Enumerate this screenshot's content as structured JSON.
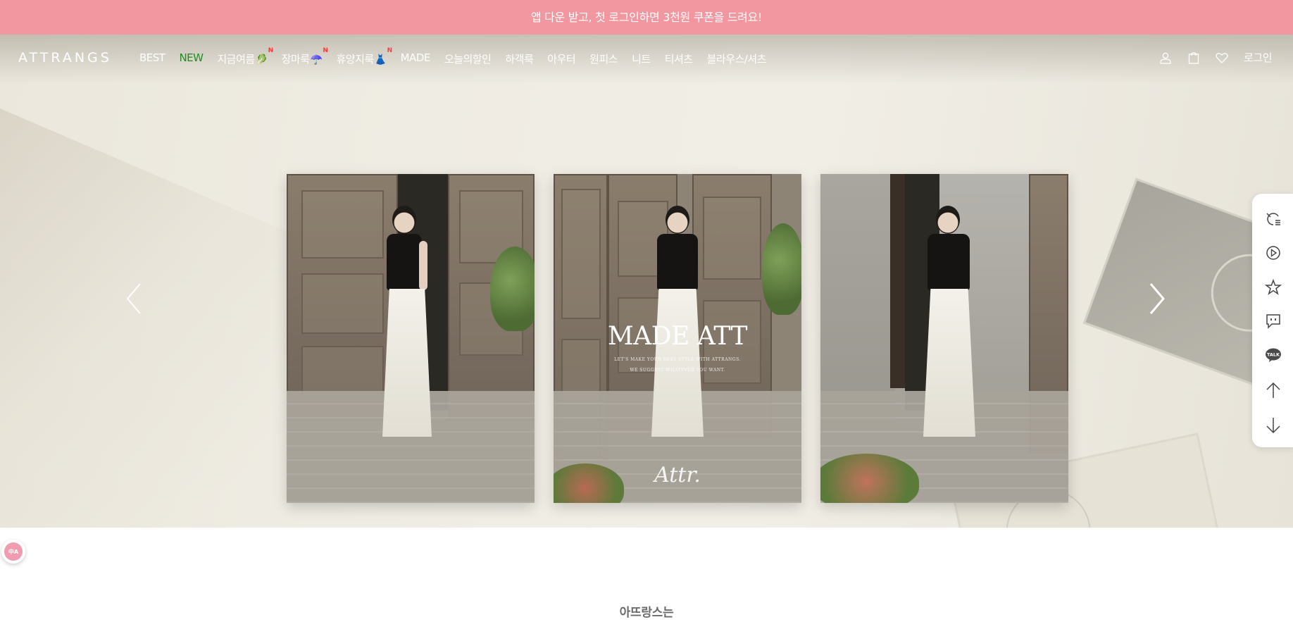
{
  "promo": {
    "text": "앱 다운 받고, 첫 로그인하면 3천원 쿠폰을 드려요!"
  },
  "header": {
    "logo": "ATTRANGS",
    "nav": [
      {
        "label": "BEST"
      },
      {
        "label": "NEW"
      },
      {
        "label": "지금여름",
        "emoji": "🥬",
        "badge": "N"
      },
      {
        "label": "장마룩",
        "emoji": "☂️",
        "badge": "N"
      },
      {
        "label": "휴양지룩",
        "emoji": "👗",
        "badge": "N"
      },
      {
        "label": "MADE"
      },
      {
        "label": "오늘의할인"
      },
      {
        "label": "하객룩"
      },
      {
        "label": "아우터"
      },
      {
        "label": "원피스"
      },
      {
        "label": "니트"
      },
      {
        "label": "티셔츠"
      },
      {
        "label": "블라우스/셔츠"
      }
    ],
    "icons": [
      "user-icon",
      "shopping-bag-icon",
      "heart-icon"
    ],
    "login": "로그인"
  },
  "hero": {
    "title": "MADE ATT",
    "subtitle_line1": "LET'S MAKE YOUR BEST STYLE WITH ATTRANGS.",
    "subtitle_line2": "WE SUGGEST WHATEVER YOU WANT.",
    "signature": "Attr."
  },
  "side_toolbar": {
    "icons": [
      "recent-view-icon",
      "video-play-icon",
      "star-icon",
      "chat-icon",
      "kakao-talk-icon",
      "arrow-up-icon",
      "arrow-down-icon"
    ],
    "talk": "TALK"
  },
  "translate_widget": {
    "label": "中A"
  },
  "section": {
    "title": "아뜨랑스는"
  },
  "colors": {
    "promo_bg": "#f2979f",
    "nav_new": "#1f8d1f",
    "badge": "#ff3d3d"
  }
}
